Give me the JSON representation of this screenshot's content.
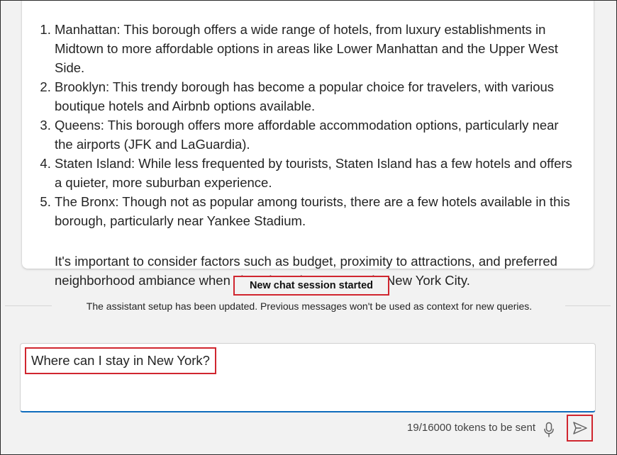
{
  "conversation": {
    "answer_items": [
      "Manhattan: This borough offers a wide range of hotels, from luxury establishments in Midtown to more affordable options in areas like Lower Manhattan and the Upper West Side.",
      "Brooklyn: This trendy borough has become a popular choice for travelers, with various boutique hotels and Airbnb options available.",
      "Queens: This borough offers more affordable accommodation options, particularly near the airports (JFK and LaGuardia).",
      "Staten Island: While less frequented by tourists, Staten Island has a few hotels and offers a quieter, more suburban experience.",
      "The Bronx: Though not as popular among tourists, there are a few hotels available in this borough, particularly near Yankee Stadium."
    ],
    "answer_note": "It's important to consider factors such as budget, proximity to attractions, and preferred neighborhood ambiance when choosing where to stay in New York City."
  },
  "session": {
    "label": "New chat session started",
    "note": "The assistant setup has been updated. Previous messages won't be used as context for new queries."
  },
  "composer": {
    "input_value": "Where can I stay in New York?",
    "token_status": "19/16000 tokens to be sent",
    "mic_icon": "microphone-icon",
    "send_icon": "send-icon"
  },
  "colors": {
    "highlight_red": "#d0262f",
    "accent_blue": "#0f6cbd",
    "background": "#f2f2f2",
    "card": "#ffffff"
  }
}
